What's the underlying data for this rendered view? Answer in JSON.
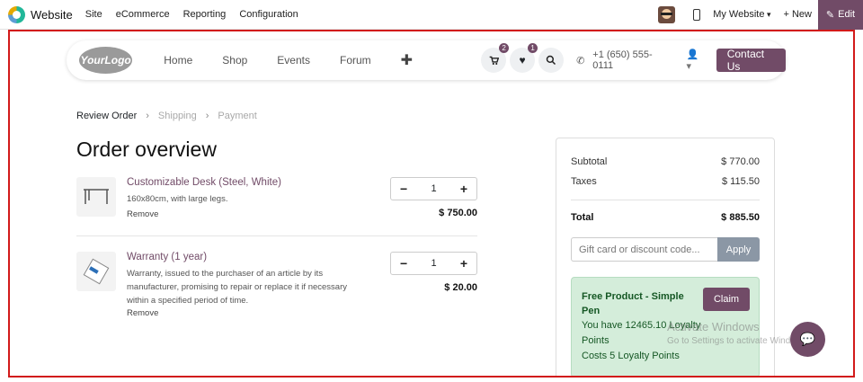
{
  "topbar": {
    "app_name": "Website",
    "menu": [
      "Site",
      "eCommerce",
      "Reporting",
      "Configuration"
    ],
    "website_selector": "My Website",
    "new_label": "+ New",
    "edit_label": "Edit"
  },
  "nav": {
    "logo_text": "YourLogo",
    "links": [
      "Home",
      "Shop",
      "Events",
      "Forum"
    ],
    "add_icon": "plus-icon",
    "cart_count": "2",
    "wishlist_count": "1",
    "phone": "+1 (650) 555-0111",
    "contact_label": "Contact Us"
  },
  "breadcrumb": {
    "steps": [
      "Review Order",
      "Shipping",
      "Payment"
    ]
  },
  "page_title": "Order overview",
  "items": [
    {
      "name": "Customizable Desk (Steel, White)",
      "description": "160x80cm, with large legs.",
      "remove": "Remove",
      "quantity": "1",
      "price": "$ 750.00"
    },
    {
      "name": "Warranty (1 year)",
      "description": "Warranty, issued to the purchaser of an article by its manufacturer, promising to repair or replace it if necessary within a specified period of time.",
      "remove": "Remove",
      "quantity": "1",
      "price": "$ 20.00"
    }
  ],
  "summary": {
    "subtotal_label": "Subtotal",
    "subtotal_value": "$ 770.00",
    "taxes_label": "Taxes",
    "taxes_value": "$ 115.50",
    "total_label": "Total",
    "total_value": "$ 885.50",
    "coupon_placeholder": "Gift card or discount code...",
    "apply_label": "Apply"
  },
  "promo": {
    "title": "Free Product - Simple Pen",
    "claim_label": "Claim",
    "line1": "You have 12465.10 Loyalty Points",
    "line2": "Costs 5 Loyalty Points"
  },
  "watermark": {
    "line1": "Activate Windows",
    "line2": "Go to Settings to activate Windows."
  },
  "colors": {
    "brand": "#714b67",
    "promo_bg": "#d4edda",
    "highlight_border": "#d21a1a"
  }
}
